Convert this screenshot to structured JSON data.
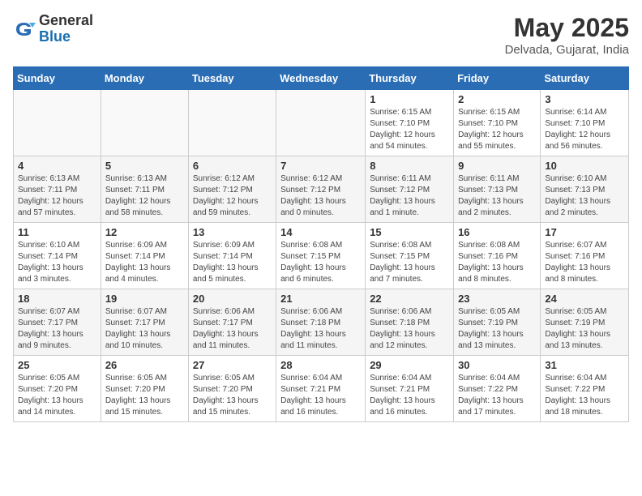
{
  "logo": {
    "general": "General",
    "blue": "Blue"
  },
  "header": {
    "month": "May 2025",
    "location": "Delvada, Gujarat, India"
  },
  "weekdays": [
    "Sunday",
    "Monday",
    "Tuesday",
    "Wednesday",
    "Thursday",
    "Friday",
    "Saturday"
  ],
  "weeks": [
    [
      {
        "day": "",
        "info": ""
      },
      {
        "day": "",
        "info": ""
      },
      {
        "day": "",
        "info": ""
      },
      {
        "day": "",
        "info": ""
      },
      {
        "day": "1",
        "info": "Sunrise: 6:15 AM\nSunset: 7:10 PM\nDaylight: 12 hours\nand 54 minutes."
      },
      {
        "day": "2",
        "info": "Sunrise: 6:15 AM\nSunset: 7:10 PM\nDaylight: 12 hours\nand 55 minutes."
      },
      {
        "day": "3",
        "info": "Sunrise: 6:14 AM\nSunset: 7:10 PM\nDaylight: 12 hours\nand 56 minutes."
      }
    ],
    [
      {
        "day": "4",
        "info": "Sunrise: 6:13 AM\nSunset: 7:11 PM\nDaylight: 12 hours\nand 57 minutes."
      },
      {
        "day": "5",
        "info": "Sunrise: 6:13 AM\nSunset: 7:11 PM\nDaylight: 12 hours\nand 58 minutes."
      },
      {
        "day": "6",
        "info": "Sunrise: 6:12 AM\nSunset: 7:12 PM\nDaylight: 12 hours\nand 59 minutes."
      },
      {
        "day": "7",
        "info": "Sunrise: 6:12 AM\nSunset: 7:12 PM\nDaylight: 13 hours\nand 0 minutes."
      },
      {
        "day": "8",
        "info": "Sunrise: 6:11 AM\nSunset: 7:12 PM\nDaylight: 13 hours\nand 1 minute."
      },
      {
        "day": "9",
        "info": "Sunrise: 6:11 AM\nSunset: 7:13 PM\nDaylight: 13 hours\nand 2 minutes."
      },
      {
        "day": "10",
        "info": "Sunrise: 6:10 AM\nSunset: 7:13 PM\nDaylight: 13 hours\nand 2 minutes."
      }
    ],
    [
      {
        "day": "11",
        "info": "Sunrise: 6:10 AM\nSunset: 7:14 PM\nDaylight: 13 hours\nand 3 minutes."
      },
      {
        "day": "12",
        "info": "Sunrise: 6:09 AM\nSunset: 7:14 PM\nDaylight: 13 hours\nand 4 minutes."
      },
      {
        "day": "13",
        "info": "Sunrise: 6:09 AM\nSunset: 7:14 PM\nDaylight: 13 hours\nand 5 minutes."
      },
      {
        "day": "14",
        "info": "Sunrise: 6:08 AM\nSunset: 7:15 PM\nDaylight: 13 hours\nand 6 minutes."
      },
      {
        "day": "15",
        "info": "Sunrise: 6:08 AM\nSunset: 7:15 PM\nDaylight: 13 hours\nand 7 minutes."
      },
      {
        "day": "16",
        "info": "Sunrise: 6:08 AM\nSunset: 7:16 PM\nDaylight: 13 hours\nand 8 minutes."
      },
      {
        "day": "17",
        "info": "Sunrise: 6:07 AM\nSunset: 7:16 PM\nDaylight: 13 hours\nand 8 minutes."
      }
    ],
    [
      {
        "day": "18",
        "info": "Sunrise: 6:07 AM\nSunset: 7:17 PM\nDaylight: 13 hours\nand 9 minutes."
      },
      {
        "day": "19",
        "info": "Sunrise: 6:07 AM\nSunset: 7:17 PM\nDaylight: 13 hours\nand 10 minutes."
      },
      {
        "day": "20",
        "info": "Sunrise: 6:06 AM\nSunset: 7:17 PM\nDaylight: 13 hours\nand 11 minutes."
      },
      {
        "day": "21",
        "info": "Sunrise: 6:06 AM\nSunset: 7:18 PM\nDaylight: 13 hours\nand 11 minutes."
      },
      {
        "day": "22",
        "info": "Sunrise: 6:06 AM\nSunset: 7:18 PM\nDaylight: 13 hours\nand 12 minutes."
      },
      {
        "day": "23",
        "info": "Sunrise: 6:05 AM\nSunset: 7:19 PM\nDaylight: 13 hours\nand 13 minutes."
      },
      {
        "day": "24",
        "info": "Sunrise: 6:05 AM\nSunset: 7:19 PM\nDaylight: 13 hours\nand 13 minutes."
      }
    ],
    [
      {
        "day": "25",
        "info": "Sunrise: 6:05 AM\nSunset: 7:20 PM\nDaylight: 13 hours\nand 14 minutes."
      },
      {
        "day": "26",
        "info": "Sunrise: 6:05 AM\nSunset: 7:20 PM\nDaylight: 13 hours\nand 15 minutes."
      },
      {
        "day": "27",
        "info": "Sunrise: 6:05 AM\nSunset: 7:20 PM\nDaylight: 13 hours\nand 15 minutes."
      },
      {
        "day": "28",
        "info": "Sunrise: 6:04 AM\nSunset: 7:21 PM\nDaylight: 13 hours\nand 16 minutes."
      },
      {
        "day": "29",
        "info": "Sunrise: 6:04 AM\nSunset: 7:21 PM\nDaylight: 13 hours\nand 16 minutes."
      },
      {
        "day": "30",
        "info": "Sunrise: 6:04 AM\nSunset: 7:22 PM\nDaylight: 13 hours\nand 17 minutes."
      },
      {
        "day": "31",
        "info": "Sunrise: 6:04 AM\nSunset: 7:22 PM\nDaylight: 13 hours\nand 18 minutes."
      }
    ]
  ]
}
